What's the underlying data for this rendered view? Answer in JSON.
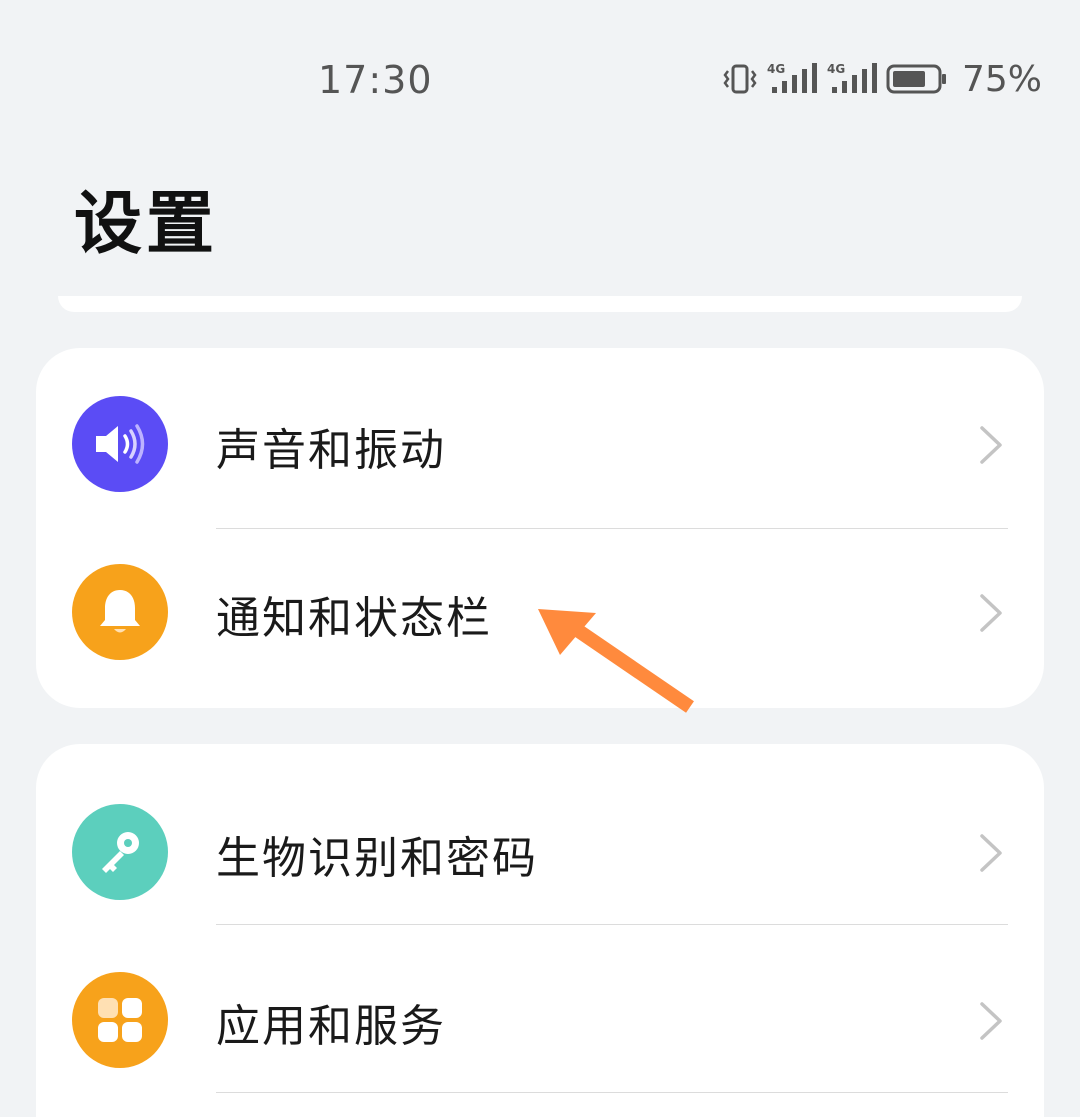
{
  "status_bar": {
    "time": "17:30",
    "network_1": "4G",
    "network_2": "4G",
    "battery_percent": "75%",
    "battery_level": 0.75,
    "icons": [
      "vibrate-icon",
      "signal-4g-icon",
      "signal-4g-icon",
      "battery-icon"
    ]
  },
  "page": {
    "title": "设置"
  },
  "sections": [
    {
      "items": [
        {
          "label": "声音和振动",
          "icon": "speaker-icon",
          "icon_color": "#5b4cf5"
        },
        {
          "label": "通知和状态栏",
          "icon": "bell-icon",
          "icon_color": "#f7a21b"
        }
      ]
    },
    {
      "items": [
        {
          "label": "生物识别和密码",
          "icon": "key-icon",
          "icon_color": "#5ccfbd"
        },
        {
          "label": "应用和服务",
          "icon": "apps-grid-icon",
          "icon_color": "#f7a21b"
        }
      ]
    }
  ],
  "annotation": {
    "type": "arrow",
    "color": "#ff8a3d",
    "points_to": "通知和状态栏"
  }
}
